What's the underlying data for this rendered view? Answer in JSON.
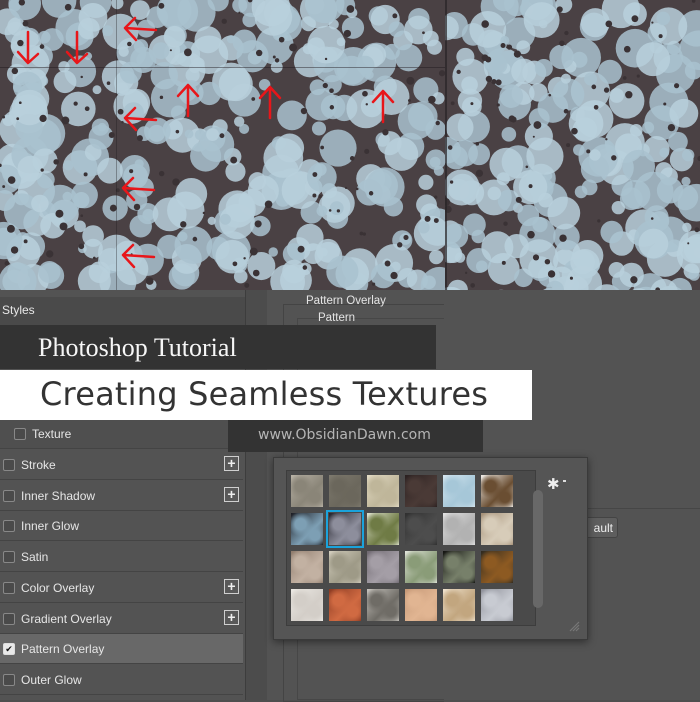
{
  "styles_panel": {
    "title": "Styles",
    "items": [
      {
        "label": "Texture",
        "checked": false,
        "has_plus": false,
        "indented": true
      },
      {
        "label": "Stroke",
        "checked": false,
        "has_plus": true
      },
      {
        "label": "Inner Shadow",
        "checked": false,
        "has_plus": true
      },
      {
        "label": "Inner Glow",
        "checked": false,
        "has_plus": false
      },
      {
        "label": "Satin",
        "checked": false,
        "has_plus": false
      },
      {
        "label": "Color Overlay",
        "checked": false,
        "has_plus": true
      },
      {
        "label": "Gradient Overlay",
        "checked": false,
        "has_plus": true
      },
      {
        "label": "Pattern Overlay",
        "checked": true,
        "has_plus": false,
        "active": true
      },
      {
        "label": "Outer Glow",
        "checked": false,
        "has_plus": false
      }
    ],
    "plus_symbol": "+",
    "check_symbol": "✔"
  },
  "pattern_overlay": {
    "group_title": "Pattern Overlay",
    "subgroup_title": "Pattern",
    "default_button_label": "ault"
  },
  "pattern_picker": {
    "gear_symbol": "✱",
    "selected_index": 7,
    "accent_color": "#1aa3dc",
    "swatches": [
      [
        "#b9b3a6",
        "#8a8578"
      ],
      [
        "#7e7a6e",
        "#6b675c"
      ],
      [
        "#e3dcc5",
        "#bfb69a"
      ],
      [
        "#2a2020",
        "#4a3a36"
      ],
      [
        "#d5e6ef",
        "#a6c7d8"
      ],
      [
        "#f2efea",
        "#6a4e32"
      ],
      [
        "#1c1c22",
        "#7d9fb4"
      ],
      [
        "#23232b",
        "#8d8e9c"
      ],
      [
        "#dfe3cf",
        "#6f7b45"
      ],
      [
        "#2f2f2f",
        "#4d4d4d"
      ],
      [
        "#e1e1e1",
        "#b2b2b2"
      ],
      [
        "#a48f76",
        "#d7ccb9"
      ],
      [
        "#8f7b6c",
        "#c2b1a2"
      ],
      [
        "#d4cfbf",
        "#9e9a87"
      ],
      [
        "#6e6870",
        "#a49ea6"
      ],
      [
        "#e3e6dc",
        "#8a9c78"
      ],
      [
        "#121210",
        "#77806a"
      ],
      [
        "#2e2a20",
        "#8d5a22"
      ],
      [
        "#ece9e4",
        "#d3cec8"
      ],
      [
        "#8a3a22",
        "#d06a42"
      ],
      [
        "#c7c4be",
        "#6f6c66"
      ],
      [
        "#c49776",
        "#e1b592"
      ],
      [
        "#f0e3cf",
        "#c2a67f"
      ],
      [
        "#8d8f98",
        "#c8cbd2"
      ]
    ]
  },
  "overlay_text": {
    "subtitle": "Photoshop Tutorial",
    "title": "Creating Seamless Textures",
    "url": "www.ObsidianDawn.com"
  },
  "colors": {
    "panel_bg": "#535353",
    "annotation_arrow": "#e8161a",
    "lichen": "#b9d0dc",
    "bark": "#4a4144"
  },
  "annotations": {
    "arrows": [
      {
        "direction": "down"
      },
      {
        "direction": "down"
      },
      {
        "direction": "left"
      },
      {
        "direction": "up"
      },
      {
        "direction": "up"
      },
      {
        "direction": "up"
      },
      {
        "direction": "left"
      },
      {
        "direction": "left"
      },
      {
        "direction": "left"
      }
    ]
  }
}
